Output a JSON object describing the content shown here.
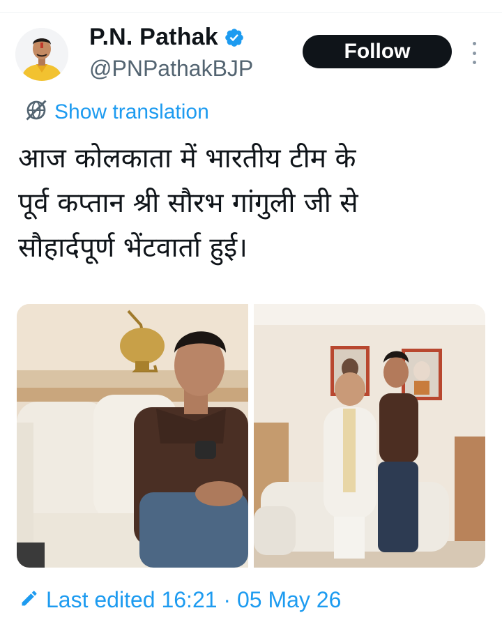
{
  "author": {
    "name": "P.N. Pathak",
    "handle": "@PNPathakBJP",
    "verified": true,
    "avatar_icon": "profile-photo"
  },
  "actions": {
    "follow_label": "Follow",
    "more_icon": "vertical-ellipsis-icon"
  },
  "translation": {
    "label": "Show translation",
    "icon": "globe-slash-icon"
  },
  "tweet": {
    "lines": [
      "आज कोलकाता में भारतीय टीम के",
      "पूर्व कप्तान श्री सौरभ गांगुली जी से",
      "सौहार्दपूर्ण भेंटवार्ता हुई।"
    ]
  },
  "media": [
    {
      "name": "photo-seated-man-white-sofa"
    },
    {
      "name": "photo-two-men-standing-portraits"
    }
  ],
  "edit_info": {
    "label": "Last edited 16:21 · 05 May 26",
    "icon": "pencil-icon"
  },
  "colors": {
    "link": "#1d9bf0",
    "primary_text": "#0f1419",
    "secondary_text": "#536471",
    "follow_bg": "#0f1419"
  }
}
